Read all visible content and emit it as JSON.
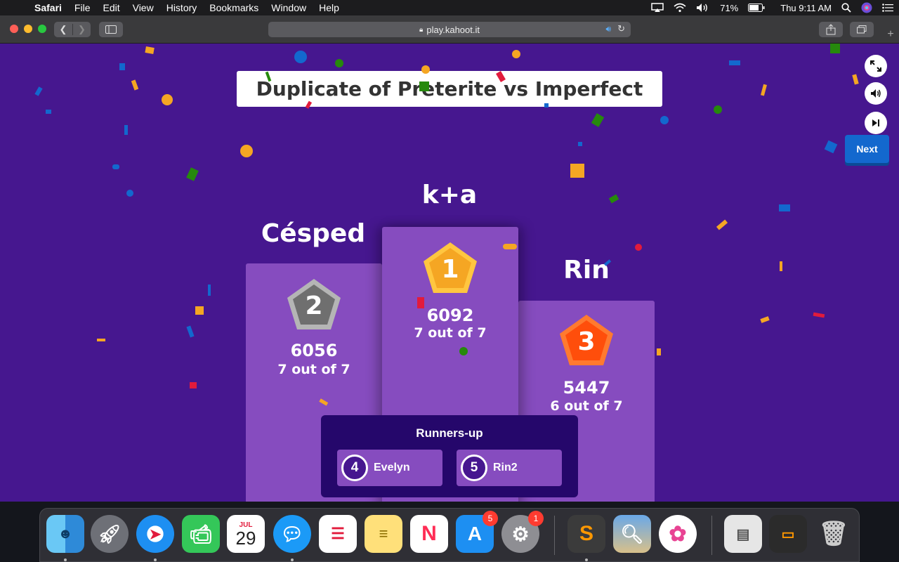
{
  "menubar": {
    "app_name": "Safari",
    "menus": [
      "File",
      "Edit",
      "View",
      "History",
      "Bookmarks",
      "Window",
      "Help"
    ],
    "battery": "71%",
    "clock": "Thu 9:11 AM"
  },
  "browser": {
    "url": "play.kahoot.it"
  },
  "game": {
    "title": "Duplicate of Preterite vs Imperfect",
    "next_label": "Next",
    "podium": [
      {
        "place": "1",
        "name": "k+a",
        "score": "6092",
        "correct": "7 out of 7",
        "medal_color": "#f5a623"
      },
      {
        "place": "2",
        "name": "Césped",
        "score": "6056",
        "correct": "7 out of 7",
        "medal_color": "#7b7b7b"
      },
      {
        "place": "3",
        "name": "Rin",
        "score": "5447",
        "correct": "6 out of 7",
        "medal_color": "#ff5a1f"
      }
    ],
    "runners_up_title": "Runners-up",
    "runners_up": [
      {
        "rank": "4",
        "name": "Evelyn"
      },
      {
        "rank": "5",
        "name": "Rin2"
      }
    ]
  },
  "dock": {
    "calendar_month": "JUL",
    "calendar_day": "29",
    "app_store_badge": "5",
    "system_prefs_badge": "1"
  }
}
